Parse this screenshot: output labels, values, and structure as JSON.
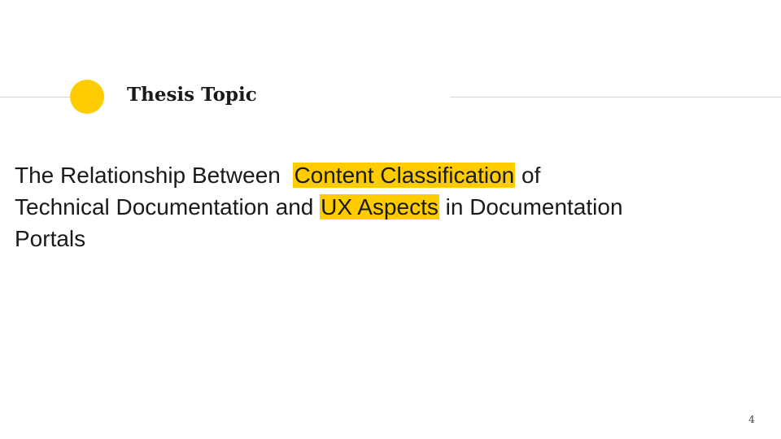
{
  "slide": {
    "title": "Thesis Topic",
    "body": {
      "text_1": "The Relationship Between  ",
      "highlight_1": "Content Classification",
      "text_2": " of Technical Documentation and ",
      "highlight_2": "UX Aspects",
      "text_3": " in Documentation Portals"
    },
    "page_number": "4",
    "accent_color": "#ffcc00"
  }
}
